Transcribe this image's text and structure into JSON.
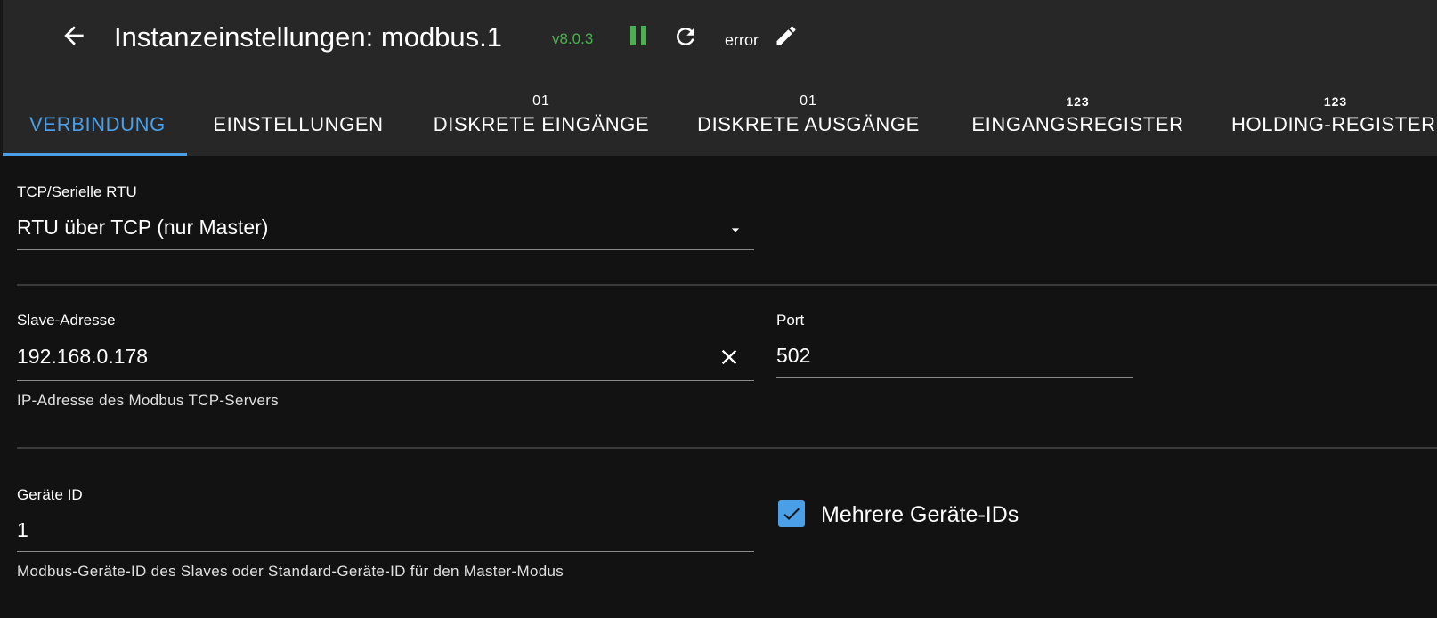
{
  "header": {
    "title": "Instanzeinstellungen: modbus.1",
    "version": "v8.0.3",
    "log_level": "error",
    "icons": {
      "back": "arrow-left-icon",
      "pause": "pause-icon",
      "reload": "reload-icon",
      "edit": "pencil-icon"
    },
    "colors": {
      "version": "#4caf50",
      "pause": "#4caf50"
    }
  },
  "tabs": [
    {
      "label": "VERBINDUNG",
      "icon_text": "",
      "active": true
    },
    {
      "label": "EINSTELLUNGEN",
      "icon_text": "",
      "active": false
    },
    {
      "label": "DISKRETE EINGÄNGE",
      "icon_text": "01",
      "active": false
    },
    {
      "label": "DISKRETE AUSGÄNGE",
      "icon_text": "01",
      "active": false
    },
    {
      "label": "EINGANGSREGISTER",
      "icon_text": "123",
      "active": false
    },
    {
      "label": "HOLDING-REGISTER",
      "icon_text": "123",
      "active": false
    }
  ],
  "accent_color": "#4a9fe6",
  "form": {
    "connection_type": {
      "label": "TCP/Serielle RTU",
      "value": "RTU über TCP (nur Master)"
    },
    "slave_address": {
      "label": "Slave-Adresse",
      "value": "192.168.0.178",
      "helper": "IP-Adresse des Modbus TCP-Servers"
    },
    "port": {
      "label": "Port",
      "value": "502"
    },
    "device_id": {
      "label": "Geräte ID",
      "value": "1",
      "helper": "Modbus-Geräte-ID des Slaves oder Standard-Geräte-ID für den Master-Modus"
    },
    "multi_device_ids": {
      "label": "Mehrere Geräte-IDs",
      "checked": true
    }
  }
}
